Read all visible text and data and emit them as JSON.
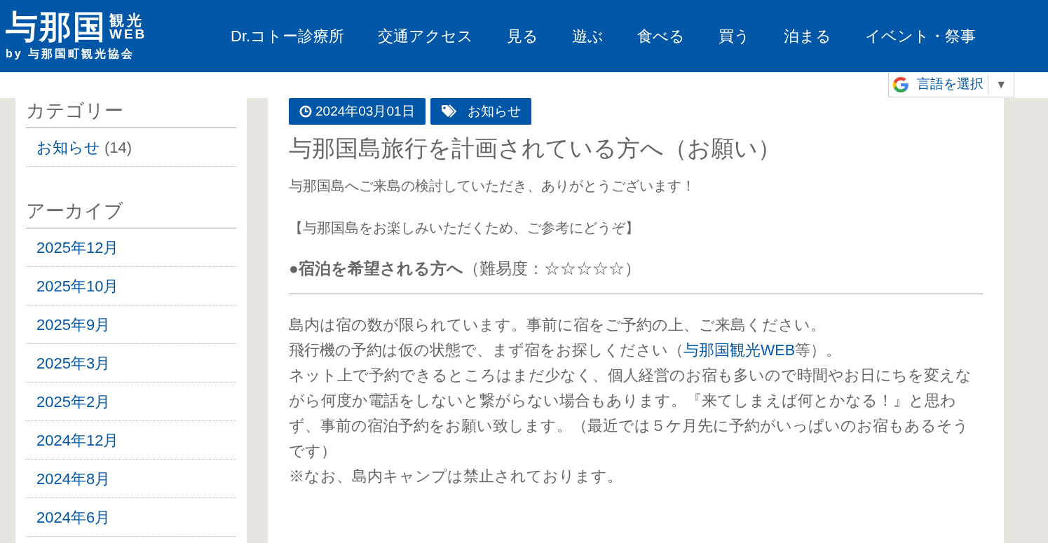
{
  "header": {
    "logo_main": "与那国",
    "logo_side_top": "観光",
    "logo_side_bottom": "WEB",
    "logo_sub": "by 与那国町観光協会",
    "nav": [
      "Dr.コトー診療所",
      "交通アクセス",
      "見る",
      "遊ぶ",
      "食べる",
      "買う",
      "泊まる",
      "イベント・祭事"
    ]
  },
  "translate": {
    "label": "言語を選択",
    "caret": "▼"
  },
  "sidebar": {
    "sections": [
      {
        "heading": "カテゴリー",
        "items": [
          {
            "label": "お知らせ",
            "count": "(14)"
          }
        ]
      },
      {
        "heading": "アーカイブ",
        "items": [
          {
            "label": "2025年12月"
          },
          {
            "label": "2025年10月"
          },
          {
            "label": "2025年9月"
          },
          {
            "label": "2025年3月"
          },
          {
            "label": "2025年2月"
          },
          {
            "label": "2024年12月"
          },
          {
            "label": "2024年8月"
          },
          {
            "label": "2024年6月"
          }
        ]
      }
    ]
  },
  "post": {
    "date": "2024年03月01日",
    "category": "お知らせ",
    "title": "与那国島旅行を計画されている方へ（お願い）",
    "intro": "与那国島へご来島の検討していただき、ありがとうございます！",
    "note": "【与那国島をお楽しみいただくため、ご参考にどうぞ】",
    "section_heading": {
      "bold": "●宿泊を希望される方へ",
      "rest": "（難易度：☆☆☆☆☆）"
    },
    "body": [
      {
        "text": "島内は宿の数が限られています。事前に宿をご予約の上、ご来島ください。"
      },
      {
        "text": "飛行機の予約は仮の状態で、まず宿をお探しください（",
        "link": "与那国観光WEB",
        "after": "等）。"
      },
      {
        "text": "ネット上で予約できるところはまだ少なく、個人経営のお宿も多いので時間やお日にちを変えながら何度か電話をしないと繋がらない場合もあります。『来てしまえば何とかなる！』と思わず、事前の宿泊予約をお願い致します。（最近では５ケ月先に予約がいっぱいのお宿もあるそうです）"
      },
      {
        "text": "※なお、島内キャンプは禁止されております。"
      }
    ]
  }
}
